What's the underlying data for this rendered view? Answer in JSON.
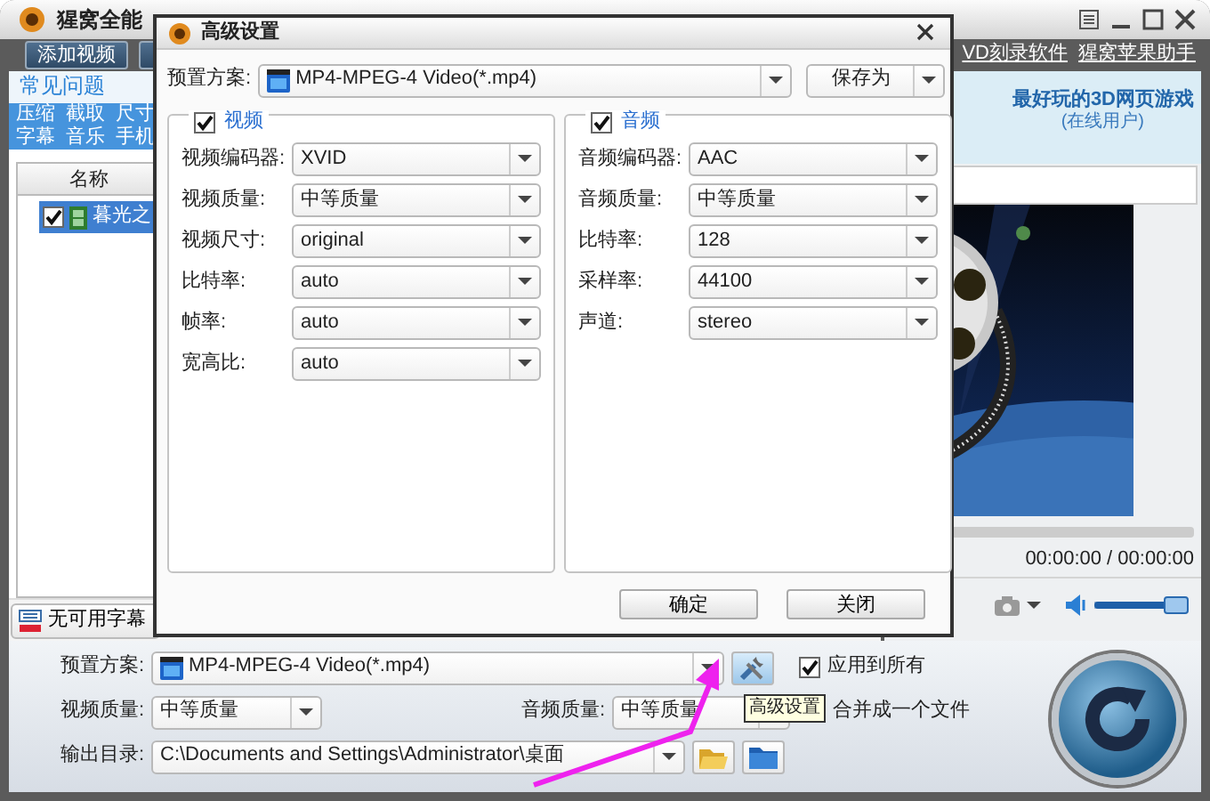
{
  "window": {
    "title": "猩窝全能",
    "toolbar_buttons": [
      "添加视频"
    ],
    "links": [
      "VD刻录软件",
      "猩窝苹果助手"
    ]
  },
  "faq": {
    "title": "常见问题",
    "link_rows": [
      {
        "links": [
          "压缩",
          "截取",
          "尺寸"
        ]
      },
      {
        "links": [
          "字幕",
          "音乐",
          "手机"
        ]
      }
    ]
  },
  "file_list": {
    "columns": [
      "名称"
    ],
    "rows": [
      {
        "name": "暮光之",
        "checked": true,
        "selected": true
      }
    ]
  },
  "subtitle_button": "无可用字幕",
  "ad": {
    "title": "最好玩的3D网页游戏",
    "subtitle": "(在线用户)"
  },
  "player": {
    "time": "00:00:00 / 00:00:00",
    "volume": {
      "level": 0.95
    }
  },
  "output": {
    "preset_label": "预置方案:",
    "preset": "MP4-MPEG-4 Video(*.mp4)",
    "apply_all": {
      "label": "应用到所有",
      "checked": true
    },
    "video_quality_label": "视频质量:",
    "video_quality": "中等质量",
    "audio_quality_label": "音频质量:",
    "audio_quality": "中等质量",
    "merge": {
      "label": "合并成一个文件"
    },
    "dir_label": "输出目录:",
    "dir": "C:\\Documents and Settings\\Administrator\\桌面"
  },
  "tooltip": "高级设置",
  "dialog": {
    "title": "高级设置",
    "preset_label": "预置方案:",
    "preset": "MP4-MPEG-4 Video(*.mp4)",
    "save_button": "保存为",
    "groups": [
      {
        "title": "视频",
        "checked": true,
        "fields": [
          {
            "label": "视频编码器:",
            "value": "XVID"
          },
          {
            "label": "视频质量:",
            "value": "中等质量"
          },
          {
            "label": "视频尺寸:",
            "value": "original"
          },
          {
            "label": "比特率:",
            "value": "auto"
          },
          {
            "label": "帧率:",
            "value": "auto"
          },
          {
            "label": "宽高比:",
            "value": "auto"
          }
        ]
      },
      {
        "title": "音频",
        "checked": true,
        "fields": [
          {
            "label": "音频编码器:",
            "value": "AAC"
          },
          {
            "label": "音频质量:",
            "value": "中等质量"
          },
          {
            "label": "比特率:",
            "value": "128"
          },
          {
            "label": "采样率:",
            "value": "44100"
          },
          {
            "label": "声道:",
            "value": "stereo"
          }
        ]
      }
    ],
    "buttons": [
      "确定",
      "关闭"
    ]
  }
}
